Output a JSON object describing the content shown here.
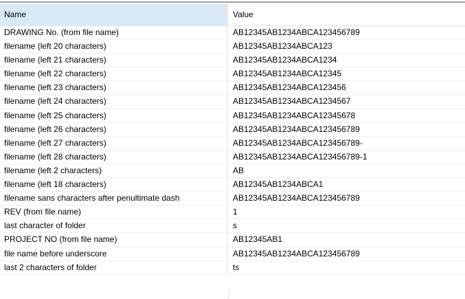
{
  "columns": {
    "name": "Name",
    "value": "Value"
  },
  "rows": [
    {
      "name": "DRAWING No. (from file name)",
      "value": "AB12345AB1234ABCA123456789"
    },
    {
      "name": "filename (left 20 characters)",
      "value": "AB12345AB1234ABCA123"
    },
    {
      "name": "filename (left 21 characters)",
      "value": "AB12345AB1234ABCA1234"
    },
    {
      "name": "filename (left 22 characters)",
      "value": "AB12345AB1234ABCA12345"
    },
    {
      "name": "filename (left 23 characters)",
      "value": "AB12345AB1234ABCA123456"
    },
    {
      "name": "filename (left 24 characters)",
      "value": "AB12345AB1234ABCA1234567"
    },
    {
      "name": "filename (left 25 characters)",
      "value": "AB12345AB1234ABCA12345678"
    },
    {
      "name": "filename (left 26 characters)",
      "value": "AB12345AB1234ABCA123456789"
    },
    {
      "name": "filename (left 27 characters)",
      "value": "AB12345AB1234ABCA123456789-"
    },
    {
      "name": "filename (left 28 characters)",
      "value": "AB12345AB1234ABCA123456789-1"
    },
    {
      "name": "filename (left 2 characters)",
      "value": "AB"
    },
    {
      "name": "filename (left 18 characters)",
      "value": "AB12345AB1234ABCA1"
    },
    {
      "name": "filename sans characters after penultimate dash",
      "value": "AB12345AB1234ABCA123456789"
    },
    {
      "name": "REV (from file name)",
      "value": "1"
    },
    {
      "name": "last character of folder",
      "value": "s"
    },
    {
      "name": "PROJECT NO (from file name)",
      "value": "AB12345AB1"
    },
    {
      "name": "file name before underscore",
      "value": "AB12345AB1234ABCA123456789"
    },
    {
      "name": "last 2 characters of folder",
      "value": "ts"
    }
  ]
}
